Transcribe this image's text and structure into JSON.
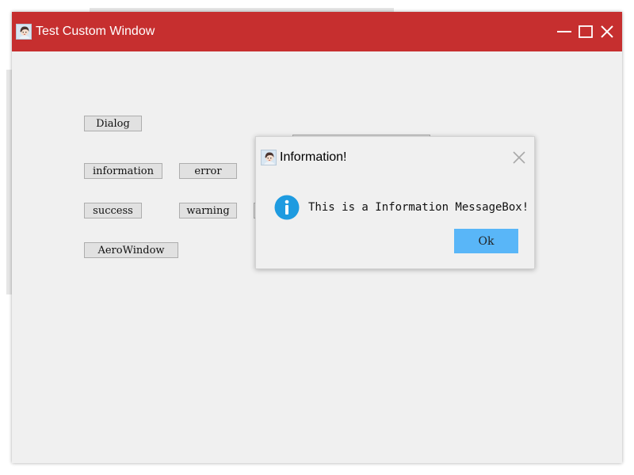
{
  "window": {
    "title": "Test Custom Window",
    "title_bar_color": "#c62f2f",
    "icons": {
      "app": "avatar-icon",
      "minimize": "minimize-icon",
      "maximize": "maximize-icon",
      "close": "close-icon"
    }
  },
  "buttons": {
    "dialog": "Dialog",
    "information": "information",
    "error": "error",
    "success": "success",
    "warning": "warning",
    "aero_window": "AeroWindow"
  },
  "message_box": {
    "title": "Information!",
    "message": "This is a Information MessageBox!",
    "ok_label": "Ok",
    "ok_color": "#59b6f8",
    "icon": "info-circle-icon",
    "icon_color": "#1e9be0"
  }
}
